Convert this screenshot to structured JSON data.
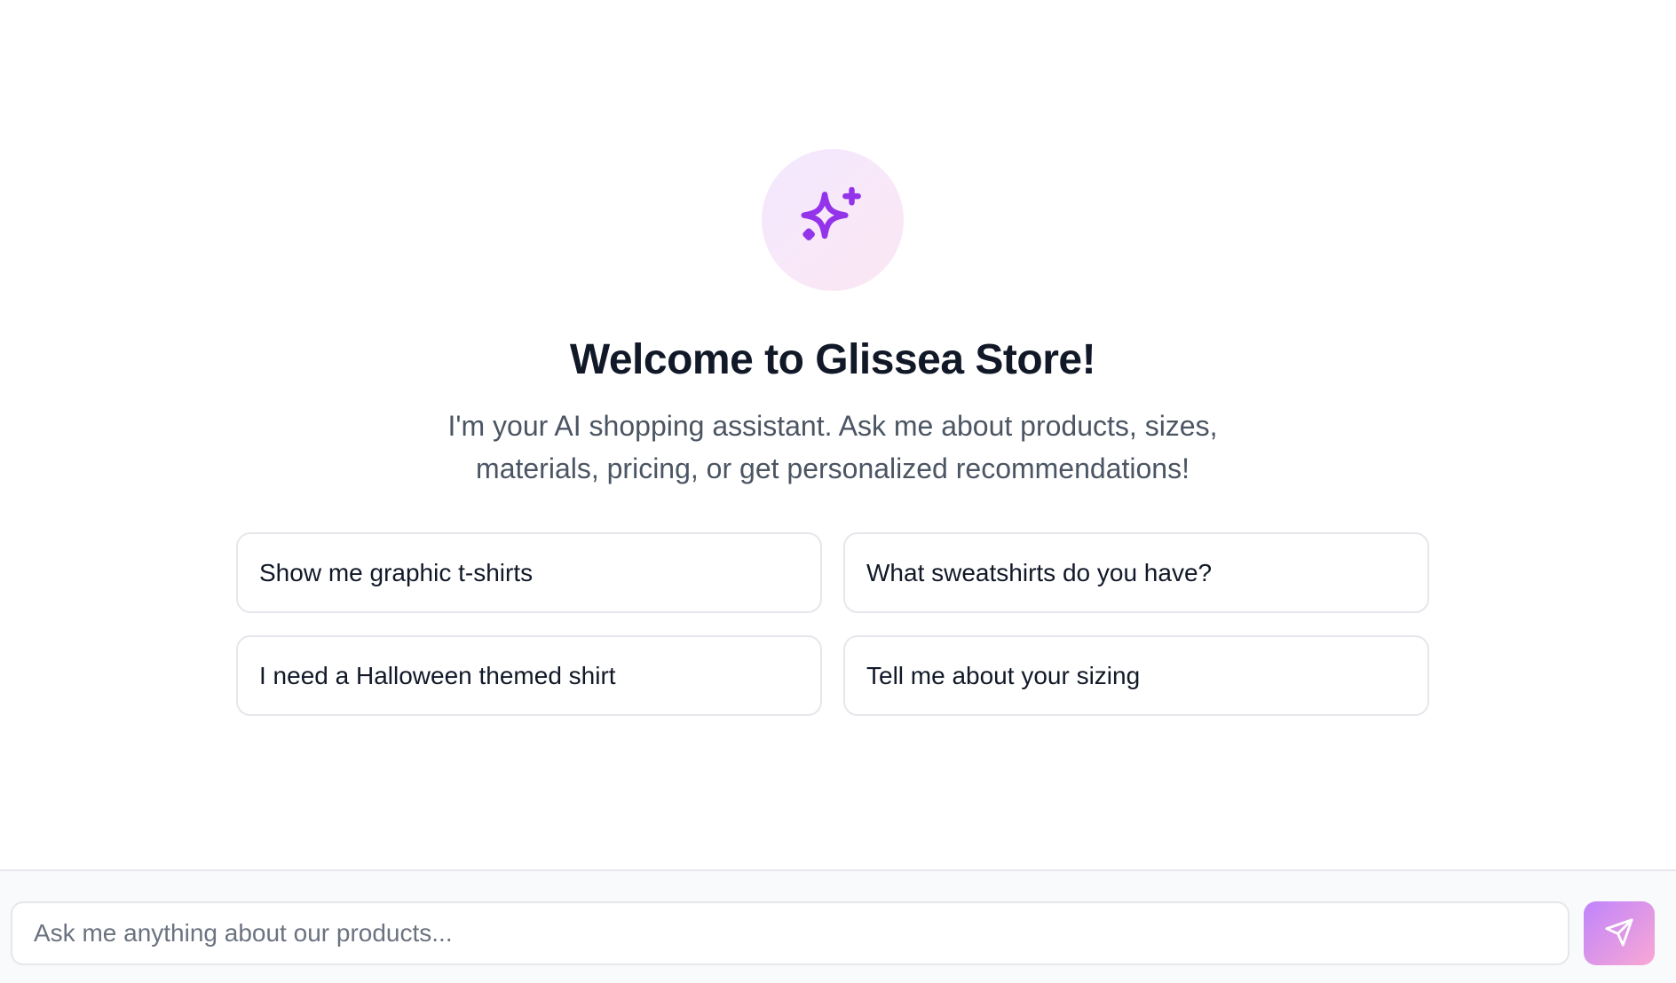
{
  "hero": {
    "icon": "sparkles-icon",
    "accent_color": "#9333ea",
    "title": "Welcome to Glissea Store!",
    "subtitle": "I'm your AI shopping assistant. Ask me about products, sizes, materials, pricing, or get personalized recommendations!"
  },
  "suggestions": [
    {
      "label": "Show me graphic t-shirts"
    },
    {
      "label": "What sweatshirts do you have?"
    },
    {
      "label": "I need a Halloween themed shirt"
    },
    {
      "label": "Tell me about your sizing"
    }
  ],
  "composer": {
    "placeholder": "Ask me anything about our products...",
    "value": "",
    "send_icon": "send-icon"
  }
}
